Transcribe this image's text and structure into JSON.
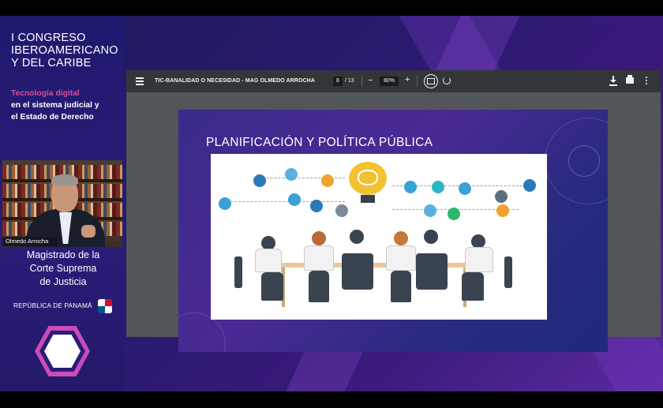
{
  "sidebar": {
    "title_lines": [
      "I CONGRESO",
      "IBEROAMERICANO",
      "Y DEL CARIBE"
    ],
    "subtitle_highlight": "Tecnología digital",
    "subtitle_lines": [
      "en el sistema judicial y",
      "el Estado de Derecho"
    ],
    "speaker_name": "Olmedo Arrocha",
    "role_lines": [
      "Magistrado de la",
      "Corte Suprema",
      "de Justicia"
    ],
    "country": "REPÚBLICA DE PANAMÁ"
  },
  "viewer": {
    "doc_title": "TIC-BANALIDAD O NECESIDAD - MAG OLMEDO ARROCHA",
    "current_page": "8",
    "total_pages": "/ 13",
    "zoom": "80%",
    "zoom_out": "−",
    "zoom_in": "+"
  },
  "slide": {
    "title": "PLANIFICACIÓN Y POLÍTICA PÚBLICA"
  },
  "colors": {
    "accent_pink": "#e0489a",
    "toolbar_bg": "#323639",
    "viewer_bg": "#525659",
    "hexagon": "#c94cb8"
  },
  "icons": [
    "menu-icon",
    "fit-to-page-icon",
    "rotate-icon",
    "download-icon",
    "print-icon",
    "more-options-icon"
  ]
}
